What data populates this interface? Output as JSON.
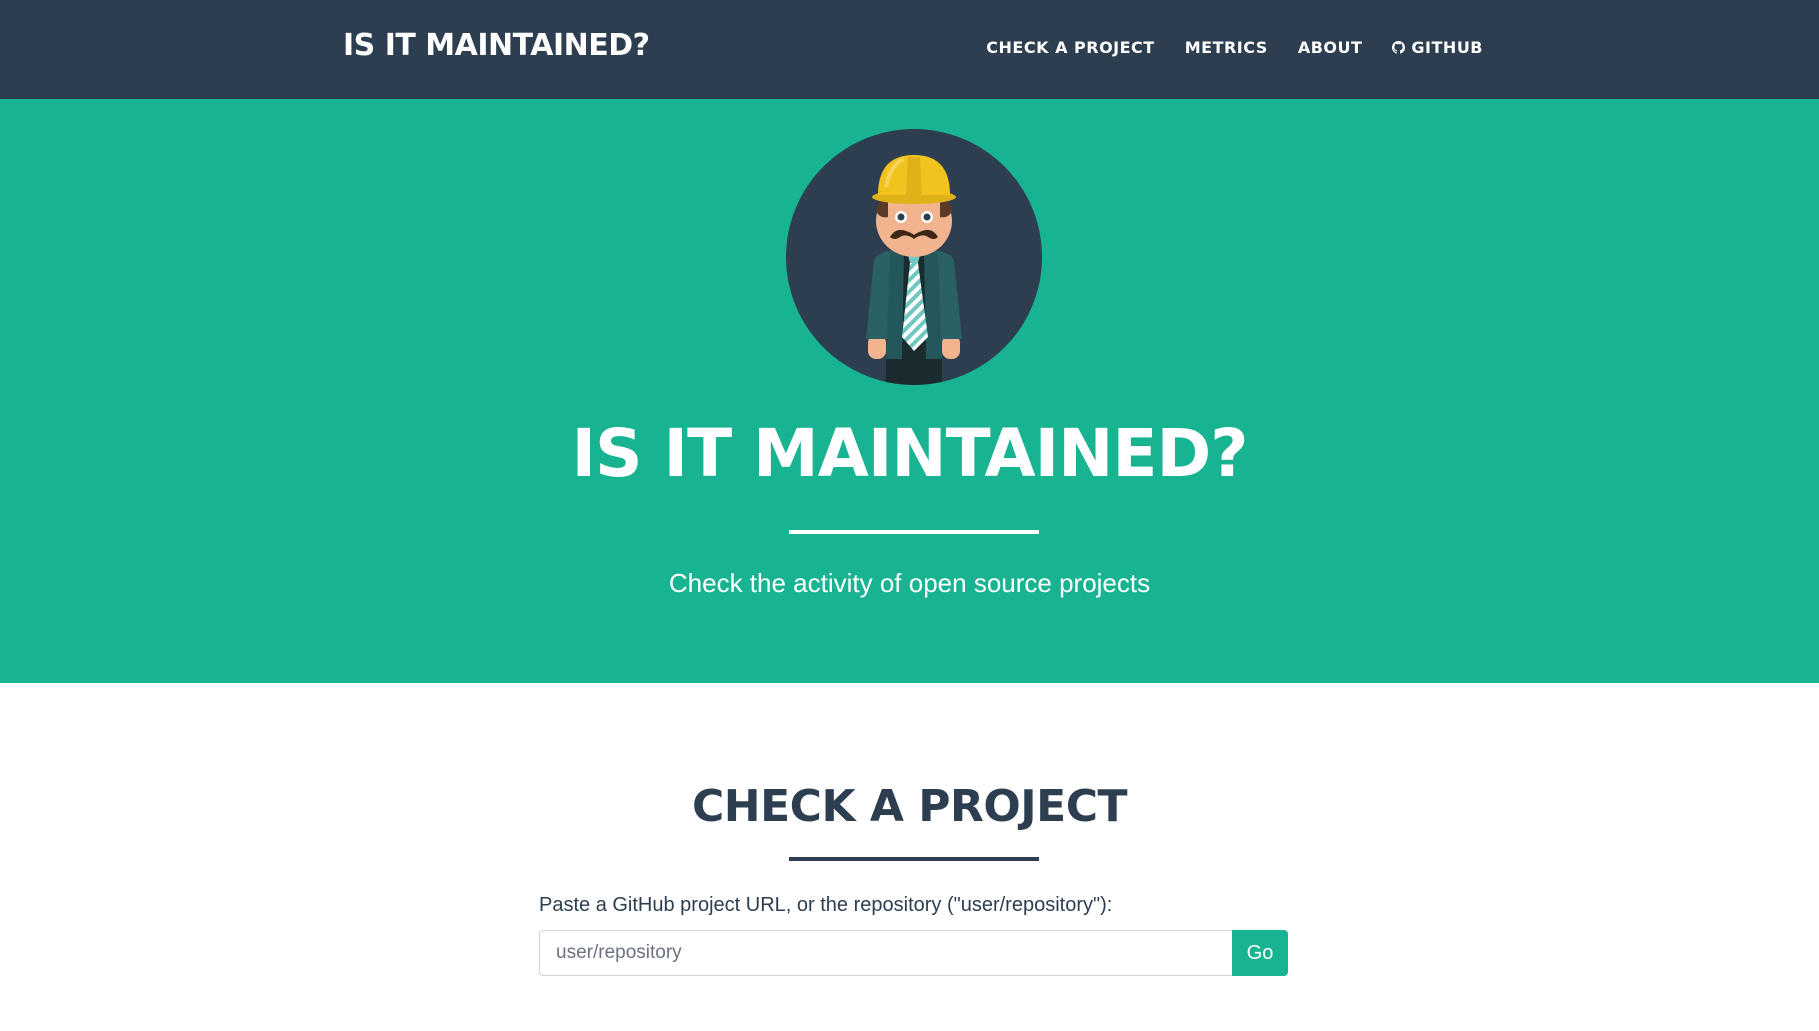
{
  "navbar": {
    "brand": "IS IT MAINTAINED?",
    "links": [
      {
        "label": "CHECK A PROJECT"
      },
      {
        "label": "METRICS"
      },
      {
        "label": "ABOUT"
      },
      {
        "label": "GITHUB",
        "icon": "github-icon"
      }
    ]
  },
  "hero": {
    "title": "IS IT MAINTAINED?",
    "subtitle": "Check the activity of open source projects",
    "avatar": "construction-worker-avatar"
  },
  "check": {
    "title": "CHECK A PROJECT",
    "label": "Paste a GitHub project URL, or the repository (\"user/repository\"):",
    "placeholder": "user/repository",
    "button": "Go"
  },
  "colors": {
    "navbar_bg": "#2c3e50",
    "hero_bg": "#18b492",
    "accent": "#18b492",
    "text_dark": "#2c3e50"
  }
}
